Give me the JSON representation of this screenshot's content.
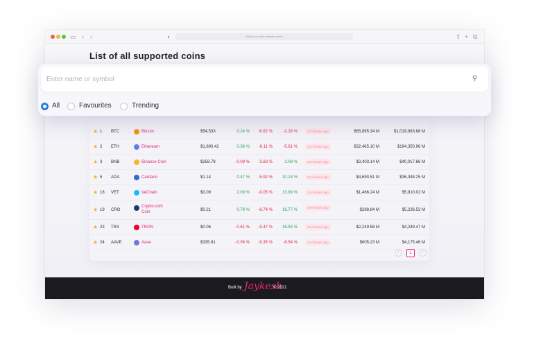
{
  "browser": {
    "url_placeholder": "Search or enter website name",
    "icons": [
      "sidebar-icon",
      "back-icon",
      "forward-icon",
      "shield-icon",
      "share-icon",
      "new-tab-icon",
      "tabs-icon"
    ]
  },
  "page": {
    "title": "List of all supported coins"
  },
  "search": {
    "placeholder": "Enter name or symbol"
  },
  "filters": [
    {
      "label": "All",
      "selected": true
    },
    {
      "label": "Favourites",
      "selected": false
    },
    {
      "label": "Trending",
      "selected": false
    }
  ],
  "coins": [
    {
      "rank": "1",
      "symbol": "BTC",
      "name": "Bitcoin",
      "price": "$54,533",
      "h1": "0.24 %",
      "h24": "-6.62 %",
      "d7": "-2.28 %",
      "updated": "22 minutes ago",
      "market_cap": "$65,895.34 M",
      "volume": "$1,018,683.88 M",
      "icon_color": "#f7931a"
    },
    {
      "rank": "2",
      "symbol": "ETH",
      "name": "Ethereum",
      "price": "$1,690.42",
      "h1": "0.38 %",
      "h24": "-6.11 %",
      "d7": "-5.61 %",
      "updated": "12 minutes ago",
      "market_cap": "$32,465.10 M",
      "volume": "$194,350.96 M",
      "icon_color": "#627eea"
    },
    {
      "rank": "3",
      "symbol": "BNB",
      "name": "Binance Coin",
      "price": "$258.78",
      "h1": "-0.09 %",
      "h24": "-3.83 %",
      "d7": "2.08 %",
      "updated": "23 minutes ago",
      "market_cap": "$3,403.14 M",
      "volume": "$40,017.66 M",
      "icon_color": "#f3ba2f"
    },
    {
      "rank": "5",
      "symbol": "ADA",
      "name": "Cardano",
      "price": "$1.14",
      "h1": "0.47 %",
      "h24": "-5.92 %",
      "d7": "10.14 %",
      "updated": "22 minutes ago",
      "market_cap": "$4,693.51 M",
      "volume": "$36,348.25 M",
      "icon_color": "#3468d1"
    },
    {
      "rank": "18",
      "symbol": "VET",
      "name": "VeChain",
      "price": "$0.09",
      "h1": "2.09 %",
      "h24": "-9.05 %",
      "d7": "13.99 %",
      "updated": "13 minutes ago",
      "market_cap": "$1,466.24 M",
      "volume": "$5,810.02 M",
      "icon_color": "#15bdff"
    },
    {
      "rank": "19",
      "symbol": "CRO",
      "name": "Crypto.com Coin",
      "price": "$0.21",
      "h1": "0.78 %",
      "h24": "-8.74 %",
      "d7": "16.77 %",
      "updated": "19 minutes ago",
      "market_cap": "$288.84 M",
      "volume": "$5,236.53 M",
      "icon_color": "#103f68"
    },
    {
      "rank": "23",
      "symbol": "TRX",
      "name": "TRON",
      "price": "$0.06",
      "h1": "-0.61 %",
      "h24": "-9.47 %",
      "d7": "16.93 %",
      "updated": "15 minutes ago",
      "market_cap": "$2,249.58 M",
      "volume": "$4,249.47 M",
      "icon_color": "#ef0027"
    },
    {
      "rank": "24",
      "symbol": "AAVE",
      "name": "Aave",
      "price": "$335.91",
      "h1": "-0.06 %",
      "h24": "-9.35 %",
      "d7": "-8.54 %",
      "updated": "12 minutes ago",
      "market_cap": "$605.23 M",
      "volume": "$4,175.46 M",
      "icon_color": "#6f7ad8"
    }
  ],
  "pagination": {
    "prev": "‹",
    "current": "1",
    "next": "›"
  },
  "footer": {
    "built_by": "Built by",
    "signature": "Jaykesh",
    "year": "© 2021"
  },
  "colors": {
    "accent": "#e0267a",
    "positive": "#2aa64a",
    "negative": "#e0283a",
    "radio_selected": "#2a7de1",
    "footer_bg": "#1b1b1f"
  }
}
